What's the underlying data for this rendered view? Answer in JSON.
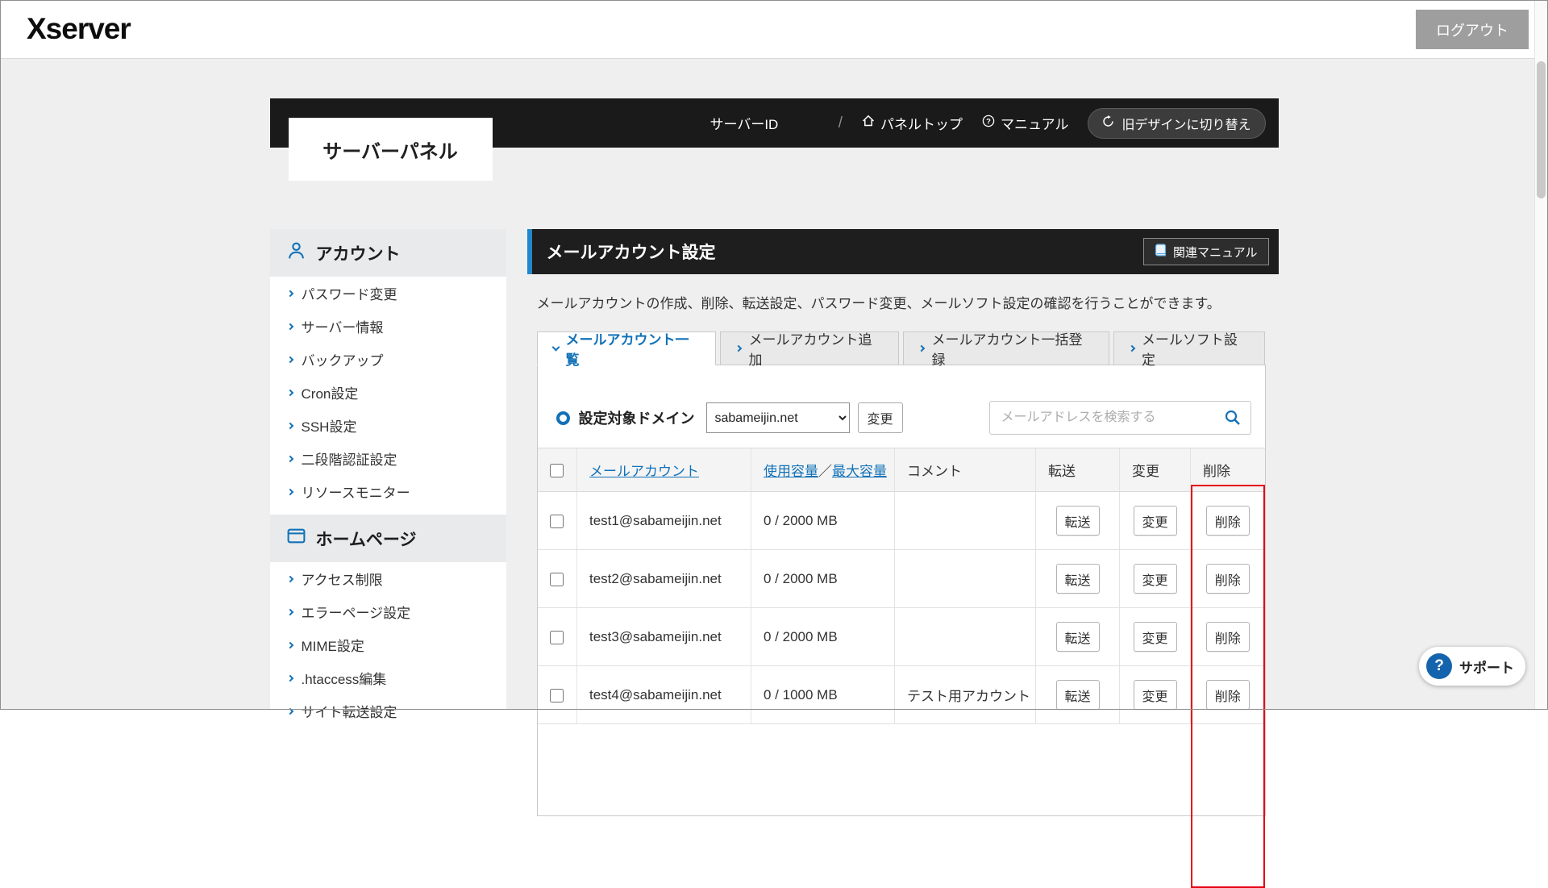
{
  "topbar": {
    "logo": "Xserver",
    "logout_label": "ログアウト"
  },
  "header_band": {
    "panel_title": "サーバーパネル",
    "server_id": "サーバーID",
    "separator": "/",
    "panel_top": "パネルトップ",
    "manual": "マニュアル",
    "switch_design": "旧デザインに切り替え"
  },
  "sidebar": {
    "sections": [
      {
        "title": "アカウント",
        "items": [
          "パスワード変更",
          "サーバー情報",
          "バックアップ",
          "Cron設定",
          "SSH設定",
          "二段階認証設定",
          "リソースモニター"
        ]
      },
      {
        "title": "ホームページ",
        "items": [
          "アクセス制限",
          "エラーページ設定",
          "MIME設定",
          ".htaccess編集",
          "サイト転送設定"
        ]
      }
    ]
  },
  "main": {
    "title": "メールアカウント設定",
    "related_manual": "関連マニュアル",
    "description": "メールアカウントの作成、削除、転送設定、パスワード変更、メールソフト設定の確認を行うことができます。",
    "tabs": [
      {
        "label": "メールアカウント一覧",
        "active": true
      },
      {
        "label": "メールアカウント追加",
        "active": false
      },
      {
        "label": "メールアカウント一括登録",
        "active": false
      },
      {
        "label": "メールソフト設定",
        "active": false
      }
    ],
    "domain": {
      "label": "設定対象ドメイン",
      "selected": "sabameijin.net",
      "change_label": "変更"
    },
    "search": {
      "placeholder": "メールアドレスを検索する"
    },
    "table": {
      "headers": {
        "account": "メールアカウント",
        "usage": "使用容量",
        "usage_separator": "／",
        "max": "最大容量",
        "comment": "コメント",
        "forward": "転送",
        "change": "変更",
        "delete": "削除"
      },
      "rows": [
        {
          "account": "test1@sabameijin.net",
          "usage": "0 / 2000 MB",
          "comment": "",
          "forward": "転送",
          "change": "変更",
          "delete": "削除"
        },
        {
          "account": "test2@sabameijin.net",
          "usage": "0 / 2000 MB",
          "comment": "",
          "forward": "転送",
          "change": "変更",
          "delete": "削除"
        },
        {
          "account": "test3@sabameijin.net",
          "usage": "0 / 2000 MB",
          "comment": "",
          "forward": "転送",
          "change": "変更",
          "delete": "削除"
        },
        {
          "account": "test4@sabameijin.net",
          "usage": "0 / 1000 MB",
          "comment": "テスト用アカウント",
          "forward": "転送",
          "change": "変更",
          "delete": "削除"
        }
      ]
    }
  },
  "support": {
    "label": "サポート"
  },
  "colors": {
    "accent": "#1272b8",
    "dark_bar": "#1a1a1a",
    "highlight_red": "#e60012",
    "page_bg": "#efefef"
  }
}
